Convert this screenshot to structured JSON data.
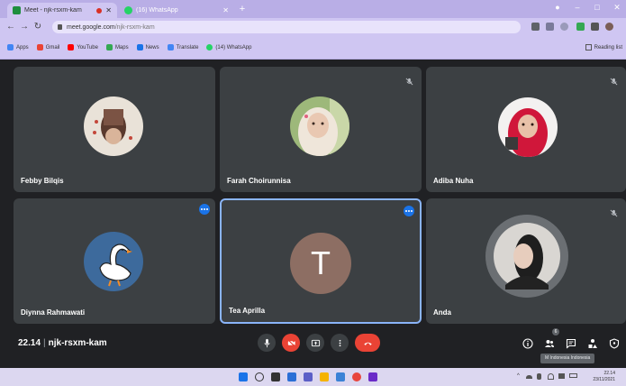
{
  "browser": {
    "tabs": [
      {
        "title": "Meet - njk-rsxm-kam",
        "active": true,
        "recording": true
      },
      {
        "title": "(16) WhatsApp",
        "active": false
      }
    ],
    "new_tab_symbol": "+",
    "window_controls": [
      "●",
      "–",
      "□",
      "✕"
    ],
    "address": {
      "host": "meet.google.com",
      "path": "/njk-rsxm-kam"
    },
    "bookmarks": [
      {
        "label": "Apps",
        "color": "#4285f4"
      },
      {
        "label": "Gmail",
        "color": "#ea4335"
      },
      {
        "label": "YouTube",
        "color": "#ff0000"
      },
      {
        "label": "Maps",
        "color": "#34a853"
      },
      {
        "label": "News",
        "color": "#1a73e8"
      },
      {
        "label": "Translate",
        "color": "#4285f4"
      },
      {
        "label": "(14) WhatsApp",
        "color": "#25d366"
      }
    ],
    "reading_list": "Reading list"
  },
  "meeting": {
    "participants": [
      {
        "name": "Febby Bilqis",
        "muted": false,
        "speaking": false
      },
      {
        "name": "Farah Choirunnisa",
        "muted": true,
        "speaking": false
      },
      {
        "name": "Adiba Nuha",
        "muted": true,
        "speaking": false
      },
      {
        "name": "Diynna Rahmawati",
        "muted": false,
        "speaking": true
      },
      {
        "name": "Tea Aprilla",
        "muted": false,
        "speaking": true,
        "initial": "T"
      },
      {
        "name": "Anda",
        "muted": true,
        "speaking": false
      }
    ],
    "time": "22.14",
    "separator": "|",
    "meeting_code": "njk-rsxm-kam",
    "participant_count": "6",
    "tooltip": "M Indonesia Indonesia"
  },
  "taskbar": {
    "clock_time": "22.14",
    "clock_date": "23/11/2021"
  },
  "colors": {
    "meet_bg": "#202124",
    "tile_bg": "#3c4043",
    "end_call_red": "#ea4335",
    "highlight_blue": "#8ab4f8"
  }
}
